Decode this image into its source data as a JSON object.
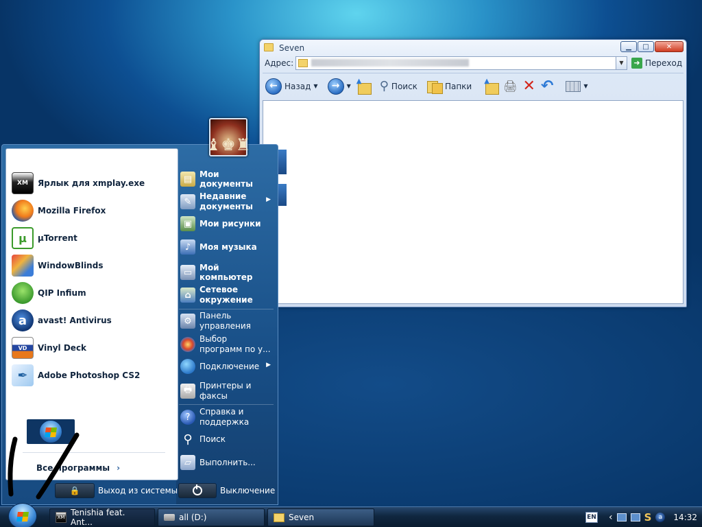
{
  "explorer": {
    "title": "Seven",
    "address_label": "Адрес:",
    "go_label": "Переход",
    "toolbar": {
      "back_label": "Назад",
      "search_label": "Поиск",
      "folders_label": "Папки"
    }
  },
  "start_menu": {
    "pinned_programs": [
      {
        "label": "Ярлык для xmplay.exe",
        "icon": "xmplay-icon"
      },
      {
        "label": "Mozilla Firefox",
        "icon": "firefox-icon"
      },
      {
        "label": "µTorrent",
        "icon": "utorrent-icon"
      },
      {
        "label": "WindowBlinds",
        "icon": "windowblinds-icon"
      },
      {
        "label": "QIP Infium",
        "icon": "qip-icon"
      },
      {
        "label": "avast! Antivirus",
        "icon": "avast-icon"
      },
      {
        "label": "Vinyl Deck",
        "icon": "vinyl-deck-icon"
      },
      {
        "label": "Adobe Photoshop CS2",
        "icon": "photoshop-icon"
      }
    ],
    "all_programs_label": "Все программы",
    "places": {
      "my_documents": "Мои документы",
      "recent_1": "Недавние",
      "recent_2": "документы",
      "my_pictures": "Мои рисунки",
      "my_music": "Моя музыка",
      "my_computer": "Мой компьютер",
      "network_1": "Сетевое",
      "network_2": "окружение",
      "control_panel_1": "Панель",
      "control_panel_2": "управления",
      "defaults_1": "Выбор",
      "defaults_2": "программ по у...",
      "connect": "Подключение",
      "printers_1": "Принтеры и",
      "printers_2": "факсы",
      "help_1": "Справка и",
      "help_2": "поддержка",
      "search": "Поиск",
      "run": "Выполнить..."
    },
    "logoff_label": "Выход из системы",
    "shutdown_label": "Выключение"
  },
  "taskbar": {
    "tasks": [
      {
        "label": "Tenishia feat. Ant...",
        "icon": "xmplay-icon"
      },
      {
        "label": "all (D:)",
        "icon": "drive-icon"
      },
      {
        "label": "Seven",
        "icon": "folder-icon"
      }
    ],
    "lang": "EN",
    "clock": "14:32"
  }
}
